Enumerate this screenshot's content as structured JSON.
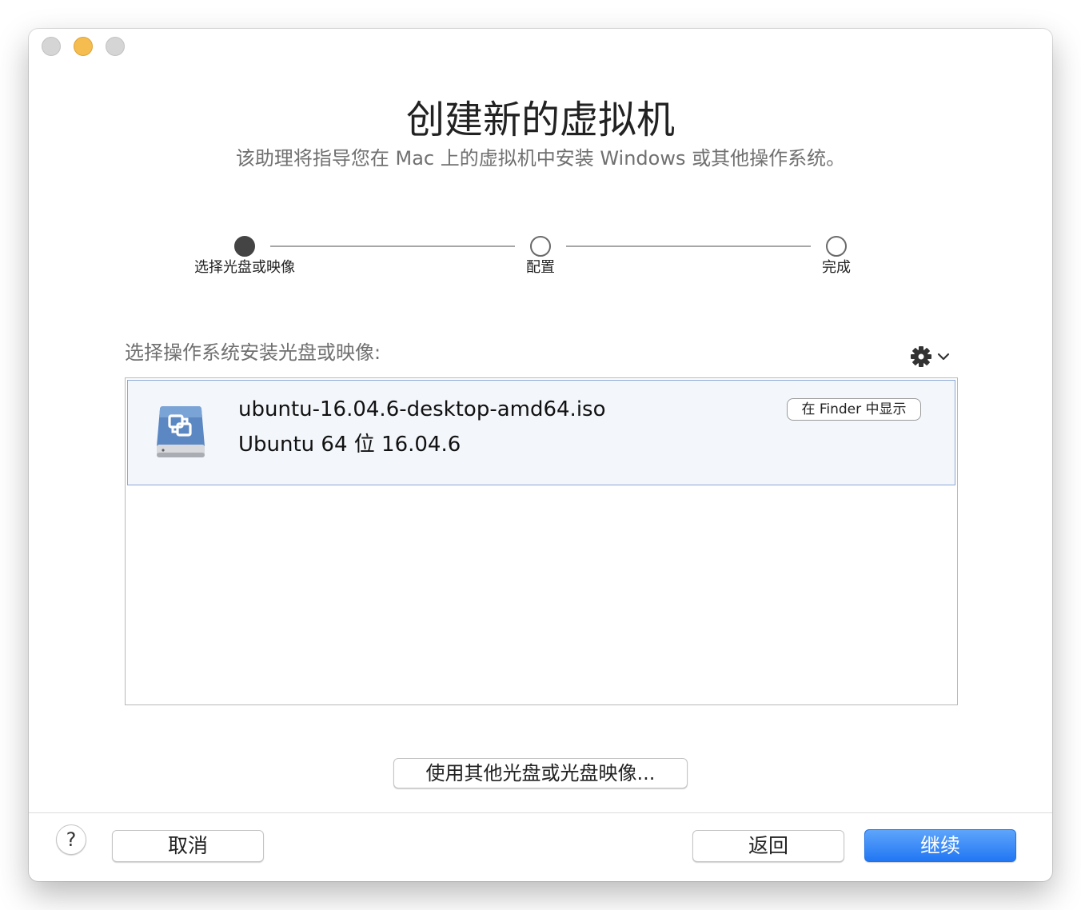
{
  "window": {
    "title": "创建新的虚拟机",
    "subtitle": "该助理将指导您在 Mac 上的虚拟机中安装 Windows 或其他操作系统。"
  },
  "steps": [
    {
      "label": "选择光盘或映像",
      "state": "active"
    },
    {
      "label": "配置",
      "state": "inactive"
    },
    {
      "label": "完成",
      "state": "inactive"
    }
  ],
  "media": {
    "section_label": "选择操作系统安装光盘或映像:",
    "gear_icon": "gear-icon",
    "items": [
      {
        "icon": "disk-image-icon",
        "name": "ubuntu-16.04.6-desktop-amd64.iso",
        "os": "Ubuntu 64 位 16.04.6",
        "finder_button": "在 Finder 中显示",
        "selected": true
      }
    ],
    "other_button": "使用其他光盘或光盘映像..."
  },
  "footer": {
    "help": "?",
    "cancel": "取消",
    "back": "返回",
    "continue": "继续"
  },
  "colors": {
    "accent": "#2176f3",
    "selected_row_bg": "#f3f6fa",
    "selected_row_border": "#8aa7d6",
    "minimize": "#f5bd4f"
  }
}
